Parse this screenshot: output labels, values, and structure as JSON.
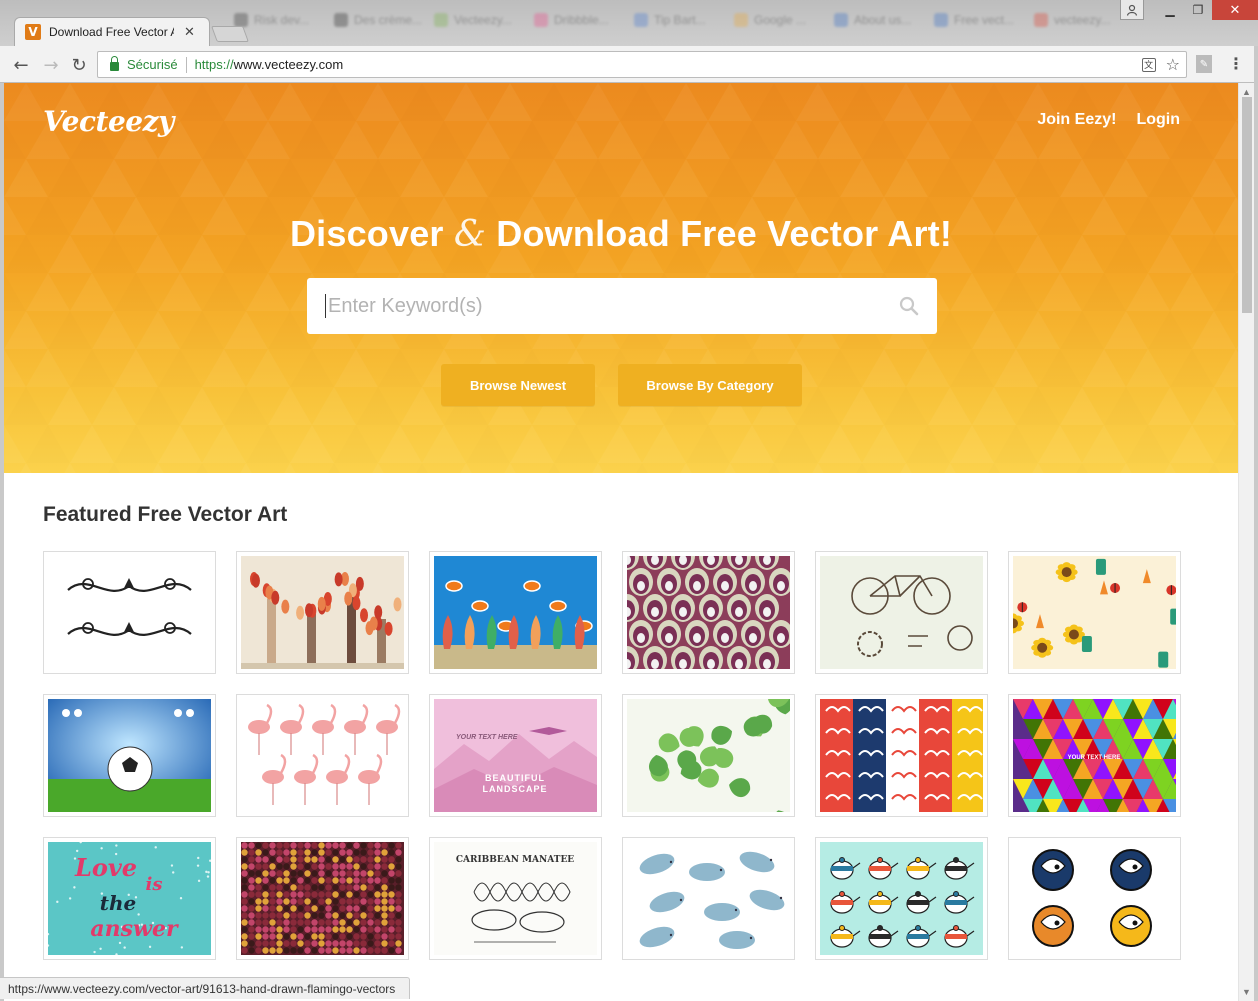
{
  "browser": {
    "active_tab_title": "Download Free Vector Art",
    "active_tab_favicon": "V",
    "background_tabs": [
      {
        "label": "Risk dev...",
        "color": "#333333"
      },
      {
        "label": "Des crème...",
        "color": "#2a2a2a"
      },
      {
        "label": "Vecteezy...",
        "color": "#7ab04c"
      },
      {
        "label": "Dribbble...",
        "color": "#ea4c89"
      },
      {
        "label": "Tip Bart...",
        "color": "#4a7bd0"
      },
      {
        "label": "Google ...",
        "color": "#e8a73a"
      },
      {
        "label": "About us...",
        "color": "#3a6fc4"
      },
      {
        "label": "Free vect...",
        "color": "#3a6fc4"
      },
      {
        "label": "vecteezy...",
        "color": "#d43"
      }
    ],
    "secure_label": "Sécurisé",
    "url_scheme": "https://",
    "url_rest": "www.vecteezy.com",
    "status_url": "https://www.vecteezy.com/vector-art/91613-hand-drawn-flamingo-vectors"
  },
  "site": {
    "logo": "Vecteezy",
    "nav": {
      "join": "Join Eezy!",
      "login": "Login"
    },
    "headline_part1": "Discover ",
    "headline_amp": "&",
    "headline_part2": " Download Free Vector Art!",
    "search_placeholder": "Enter Keyword(s)",
    "browse_newest": "Browse Newest",
    "browse_category": "Browse By Category",
    "featured_title": "Featured Free Vector Art",
    "brand_orange": "#ec8a1f",
    "brand_yellow": "#fbd24c"
  },
  "thumbnails": [
    {
      "name": "ornamental-swirls",
      "bg": "#ffffff"
    },
    {
      "name": "autumn-trees",
      "bg": "#efe6d6"
    },
    {
      "name": "underwater-reef",
      "bg": "#2b8fd6"
    },
    {
      "name": "peacock-pattern",
      "bg": "#8c3d5a"
    },
    {
      "name": "bicycle-line-art",
      "bg": "#eef2e6"
    },
    {
      "name": "garden-pattern",
      "bg": "#fbf1d7"
    },
    {
      "name": "soccer-stadium",
      "bg": "#2a72c6"
    },
    {
      "name": "flamingos",
      "bg": "#ffffff"
    },
    {
      "name": "pink-landscape",
      "bg": "#efb6d6",
      "text1": "YOUR TEXT HERE",
      "text2": "BEAUTIFUL LANDSCAPE"
    },
    {
      "name": "ginkgo-leaves",
      "bg": "#f4f7ee"
    },
    {
      "name": "chinese-cloud-patterns",
      "bg": "#ffffff"
    },
    {
      "name": "colorful-geometric",
      "bg": "#5a2c8a",
      "text1": "YOUR TEXT HERE"
    },
    {
      "name": "love-lettering",
      "bg": "#5bc6c6",
      "text1": "Love",
      "text2": "is",
      "text3": "the",
      "text4": "answer"
    },
    {
      "name": "mosaic-bokeh",
      "bg": "#5a1f2a"
    },
    {
      "name": "caribbean-manatee",
      "bg": "#fbfbf8",
      "text1": "CARIBBEAN MANATEE"
    },
    {
      "name": "manatees",
      "bg": "#ffffff"
    },
    {
      "name": "teapots",
      "bg": "#b5ece4"
    },
    {
      "name": "sports-mascots",
      "bg": "#ffffff"
    }
  ]
}
